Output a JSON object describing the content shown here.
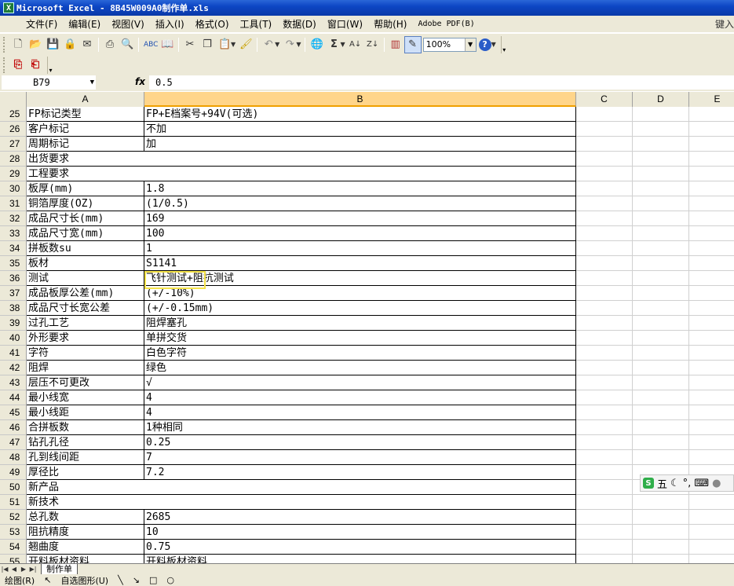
{
  "window": {
    "title": "Microsoft Excel - 8B45W009A0制作单.xls",
    "icon": "excel-icon"
  },
  "menu": {
    "items": [
      "文件(F)",
      "编辑(E)",
      "视图(V)",
      "插入(I)",
      "格式(O)",
      "工具(T)",
      "数据(D)",
      "窗口(W)",
      "帮助(H)",
      "Adobe PDF(B)"
    ],
    "help_box": "键入"
  },
  "toolbar": {
    "zoom": "100%",
    "icons": [
      "new-icon",
      "open-icon",
      "save-icon",
      "permission-icon",
      "email-icon",
      "print-icon",
      "print-preview-icon",
      "spelling-icon",
      "research-icon",
      "cut-icon",
      "copy-icon",
      "paste-icon",
      "format-painter-icon",
      "undo-icon",
      "redo-icon",
      "hyperlink-icon",
      "autosum-icon",
      "sort-ascending-icon",
      "sort-descending-icon",
      "chart-wizard-icon",
      "drawing-icon",
      "help-icon"
    ]
  },
  "pdf_toolbar": {
    "icons": [
      "convert-to-pdf-icon",
      "convert-and-email-pdf-icon"
    ]
  },
  "formula_bar": {
    "name_box": "B79",
    "fx": "fx",
    "value": "0.5"
  },
  "columns": [
    "A",
    "B",
    "C",
    "D",
    "E"
  ],
  "rows": [
    {
      "num": "25",
      "a": "FP标记类型",
      "b": "FP+E档案号+94V(可选)"
    },
    {
      "num": "26",
      "a": "客户标记",
      "b": "不加"
    },
    {
      "num": "27",
      "a": "周期标记",
      "b": "加"
    },
    {
      "num": "28",
      "a": "出货要求",
      "b": "",
      "merged": true
    },
    {
      "num": "29",
      "a": "工程要求",
      "b": "",
      "merged": true
    },
    {
      "num": "30",
      "a": "板厚(mm)",
      "b": "1.8"
    },
    {
      "num": "31",
      "a": "铜箔厚度(OZ)",
      "b": " (1/0.5)"
    },
    {
      "num": "32",
      "a": "成品尺寸长(mm)",
      "b": "169"
    },
    {
      "num": "33",
      "a": "成品尺寸宽(mm)",
      "b": "100"
    },
    {
      "num": "34",
      "a": "拼板数su",
      "b": "1"
    },
    {
      "num": "35",
      "a": "板材",
      "b": "S1141"
    },
    {
      "num": "36",
      "a": "测试",
      "b": "飞针测试+阻抗测试"
    },
    {
      "num": "37",
      "a": "成品板厚公差(mm)",
      "b": "(+/-10%)"
    },
    {
      "num": "38",
      "a": "成品尺寸长宽公差",
      "b": "(+/-0.15mm)"
    },
    {
      "num": "39",
      "a": "过孔工艺",
      "b": "阻焊塞孔"
    },
    {
      "num": "40",
      "a": "外形要求",
      "b": "单拼交货"
    },
    {
      "num": "41",
      "a": "字符",
      "b": "白色字符"
    },
    {
      "num": "42",
      "a": "阻焊",
      "b": "绿色"
    },
    {
      "num": "43",
      "a": "层压不可更改",
      "b": "√"
    },
    {
      "num": "44",
      "a": "最小线宽",
      "b": "4"
    },
    {
      "num": "45",
      "a": "最小线距",
      "b": "4"
    },
    {
      "num": "46",
      "a": "合拼板数",
      "b": "1种相同"
    },
    {
      "num": "47",
      "a": "钻孔孔径",
      "b": "0.25"
    },
    {
      "num": "48",
      "a": "孔到线间距",
      "b": "7"
    },
    {
      "num": "49",
      "a": "厚径比",
      "b": "7.2"
    },
    {
      "num": "50",
      "a": "新产品",
      "b": "",
      "merged": true
    },
    {
      "num": "51",
      "a": "新技术",
      "b": "",
      "merged": true
    },
    {
      "num": "52",
      "a": "总孔数",
      "b": "2685"
    },
    {
      "num": "53",
      "a": "阻抗精度",
      "b": "10"
    },
    {
      "num": "54",
      "a": "翘曲度",
      "b": "0.75"
    },
    {
      "num": "55",
      "a": "开料板材资料",
      "b": "开料板材资料"
    }
  ],
  "sheet_tabs": [
    "制作单"
  ],
  "draw_bar": {
    "draw_label": "绘图(R)",
    "autoshapes_label": "自选图形(U)"
  },
  "ime": {
    "label": "五",
    "icons": [
      "sogou-icon",
      "moon-icon",
      "punctuation-icon",
      "keyboard-icon",
      "user-icon"
    ]
  }
}
